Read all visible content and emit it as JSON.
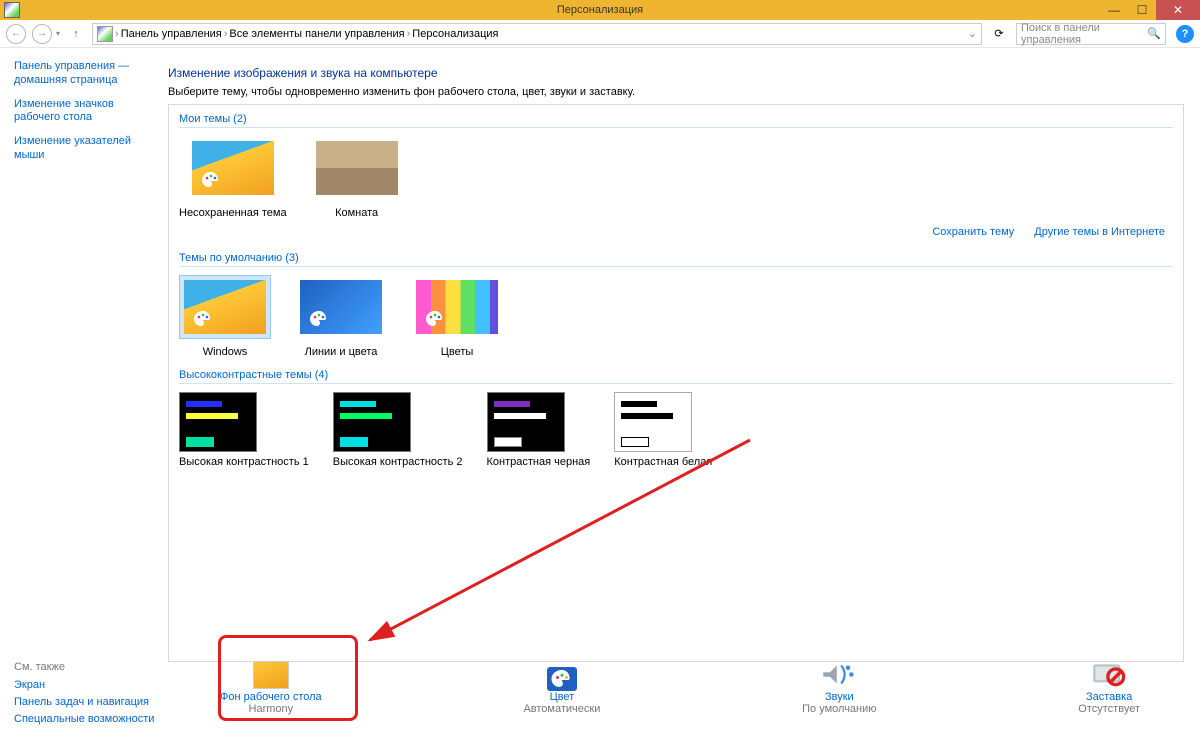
{
  "window": {
    "title": "Персонализация"
  },
  "breadcrumb": {
    "items": [
      "Панель управления",
      "Все элементы панели управления",
      "Персонализация"
    ]
  },
  "search": {
    "placeholder": "Поиск в панели управления"
  },
  "sidebar": {
    "home": "Панель управления — домашняя страница",
    "items": [
      "Изменение значков рабочего стола",
      "Изменение указателей мыши"
    ]
  },
  "main": {
    "heading": "Изменение изображения и звука на компьютере",
    "subtext": "Выберите тему, чтобы одновременно изменить фон рабочего стола, цвет, звуки и заставку."
  },
  "groups": {
    "my": {
      "title": "Мои темы (2)",
      "items": [
        "Несохраненная тема",
        "Комната"
      ]
    },
    "links": {
      "save": "Сохранить тему",
      "more": "Другие темы в Интернете"
    },
    "default": {
      "title": "Темы по умолчанию (3)",
      "items": [
        "Windows",
        "Линии и цвета",
        "Цветы"
      ]
    },
    "hc": {
      "title": "Высококонтрастные темы (4)",
      "items": [
        "Высокая контрастность 1",
        "Высокая контрастность 2",
        "Контрастная черная",
        "Контрастная белая"
      ]
    }
  },
  "bottom": {
    "see_also": {
      "hdr": "См. также",
      "items": [
        "Экран",
        "Панель задач и навигация",
        "Специальные возможности"
      ]
    },
    "items": [
      {
        "label": "Фон рабочего стола",
        "desc": "Harmony"
      },
      {
        "label": "Цвет",
        "desc": "Автоматически"
      },
      {
        "label": "Звуки",
        "desc": "По умолчанию"
      },
      {
        "label": "Заставка",
        "desc": "Отсутствует"
      }
    ]
  }
}
